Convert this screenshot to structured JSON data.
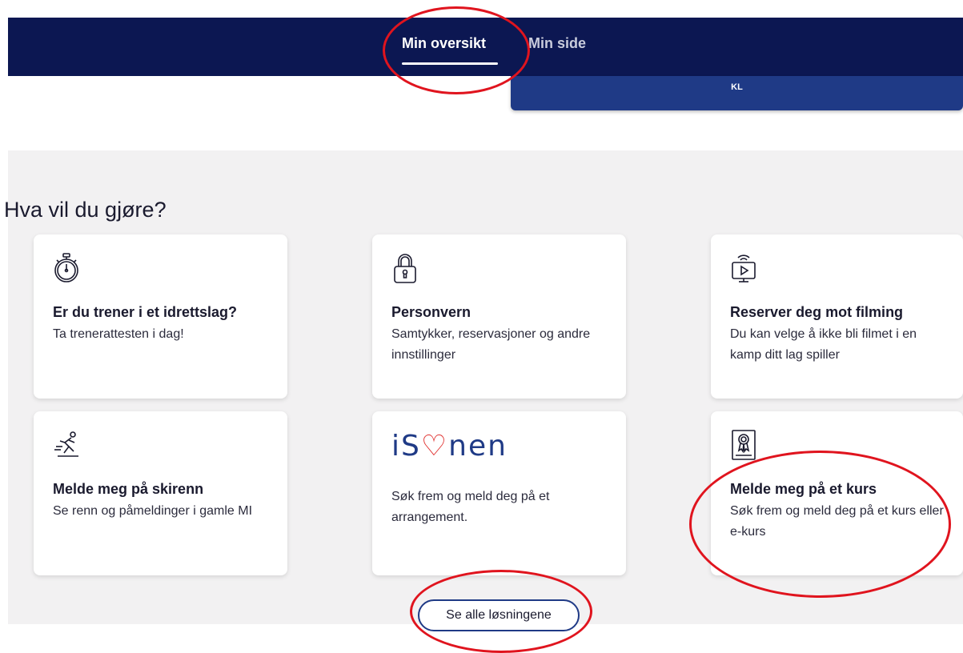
{
  "nav": {
    "tabs": [
      {
        "label": "Min oversikt",
        "active": true
      },
      {
        "label": "Min side",
        "active": false
      }
    ],
    "user_initials": "KL"
  },
  "section": {
    "title": "Hva vil du gjøre?",
    "cards": [
      {
        "icon": "stopwatch-icon",
        "title": "Er du trener i et idrettslag?",
        "desc": "Ta trenerattesten i dag!"
      },
      {
        "icon": "padlock-icon",
        "title": "Personvern",
        "desc": "Samtykker, reservasjoner og andre innstillinger"
      },
      {
        "icon": "broadcast-screen-icon",
        "title": "Reserver deg mot filming",
        "desc": "Du kan velge å ikke bli filmet i en kamp ditt lag spiller"
      },
      {
        "icon": "skier-icon",
        "title": "Melde meg på skirenn",
        "desc": "Se renn og påmeldinger i gamle MI"
      },
      {
        "logo": "isonen",
        "logo_text_a": "iS",
        "logo_text_b": "nen",
        "title": "",
        "desc": "Søk frem og meld deg på et arrangement."
      },
      {
        "icon": "certificate-icon",
        "title": "Melde meg på et kurs",
        "desc": "Søk frem og meld deg på et kurs eller e-kurs"
      }
    ],
    "see_all_label": "Se alle løsningene"
  },
  "colors": {
    "navy": "#0c1752",
    "blue": "#1f3a86",
    "annotation_red": "#e0141e",
    "brand_heart": "#e0312f"
  }
}
